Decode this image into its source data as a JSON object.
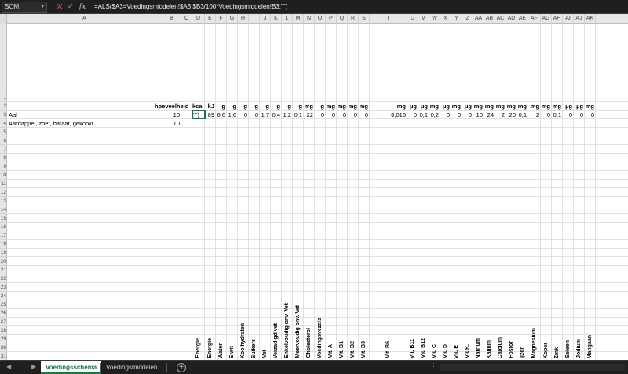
{
  "formula_bar": {
    "name_box": "SOM",
    "formula": "=ALS($A3=Voedingsmiddelen!$A3;$B3/100*Voedingsmiddelen!B3;\"\")"
  },
  "columns": [
    "A",
    "B",
    "C",
    "D",
    "E",
    "F",
    "G",
    "H",
    "I",
    "J",
    "K",
    "L",
    "M",
    "N",
    "O",
    "P",
    "Q",
    "R",
    "S",
    "T",
    "U",
    "V",
    "W",
    "X",
    "Y",
    "Z",
    "AA",
    "AB",
    "AC",
    "AD",
    "AE",
    "AF",
    "AG",
    "AH",
    "AI",
    "AJ",
    "AK"
  ],
  "rows": [
    "1",
    "2",
    "3",
    "4",
    "5",
    "6",
    "7",
    "8",
    "9",
    "10",
    "11",
    "12",
    "13",
    "14",
    "15",
    "16",
    "17",
    "18",
    "19",
    "20",
    "21",
    "22",
    "23",
    "24",
    "25",
    "26",
    "27",
    "28",
    "29",
    "30",
    "31"
  ],
  "row1_headers": {
    "D": "Energie",
    "E": "Energie",
    "F": "Water",
    "G": "Eiwit",
    "H": "Koolhydraten",
    "I": "Suikers",
    "J": "Vet",
    "K": "Verzadigd vet",
    "L": "Enkelvoudig onv. Vet",
    "M": "Meervoudig onv. Vet",
    "N": "Cholesterol",
    "O": "Voedingsvezels",
    "P": "Vit. A",
    "Q": "Vit. B1",
    "R": "Vit. B2",
    "S": "Vit. B3",
    "T": "Vit. B6",
    "U": "Vit. B11",
    "V": "Vit. B12",
    "W": "Vit. C",
    "X": "Vit. D",
    "Y": "Vit. E",
    "Z": "Vit K.",
    "AA": "Natrium",
    "AB": "Kalium",
    "AC": "Calcium",
    "AD": "Fosfor",
    "AE": "Ijzer",
    "AF": "Magnesium",
    "AG": "Koper",
    "AH": "Zink",
    "AI": "Seleen",
    "AJ": "Jodium",
    "AK": "Mangaan"
  },
  "row2": {
    "B": "hoeveelheid",
    "D": "kcal",
    "E": "kJ",
    "F": "g",
    "G": "g",
    "H": "g",
    "I": "g",
    "J": "g",
    "K": "g",
    "L": "g",
    "M": "g",
    "N": "mg",
    "O": "g",
    "P": "mg",
    "Q": "mg",
    "R": "mg",
    "S": "mg",
    "T": "mg",
    "U": "µg",
    "V": "µg",
    "W": "mg",
    "X": "µg",
    "Y": "mg",
    "Z": "µg",
    "AA": "mg",
    "AB": "mg",
    "AC": "mg",
    "AD": "mg",
    "AE": "mg",
    "AF": "mg",
    "AG": "mg",
    "AH": "mg",
    "AI": "µg",
    "AJ": "µg",
    "AK": "mg"
  },
  "row3": {
    "A": "Aal",
    "B": "10",
    "D": "\"\")",
    "E": "89",
    "F": "6,6",
    "G": "1,6",
    "H": "0",
    "I": "0",
    "J": "1,7",
    "K": "0,4",
    "L": "1,2",
    "M": "0,1",
    "N": "22",
    "O": "0",
    "P": "0",
    "Q": "0",
    "R": "0",
    "S": "0",
    "T": "0,016",
    "U": "0",
    "V": "0,1",
    "W": "0,2",
    "X": "0",
    "Y": "0",
    "Z": "0",
    "AA": "10",
    "AB": "24",
    "AC": "2",
    "AD": "20",
    "AE": "0,1",
    "AF": "2",
    "AG": "0",
    "AH": "0,1",
    "AI": "0",
    "AJ": "0",
    "AK": "0"
  },
  "row4": {
    "A": "Aardappel, zoet, bataat, gekookt",
    "B": "10"
  },
  "tabs": {
    "active": "Voedingsschema",
    "other": "Voedingsmiddelen",
    "add": "+"
  }
}
